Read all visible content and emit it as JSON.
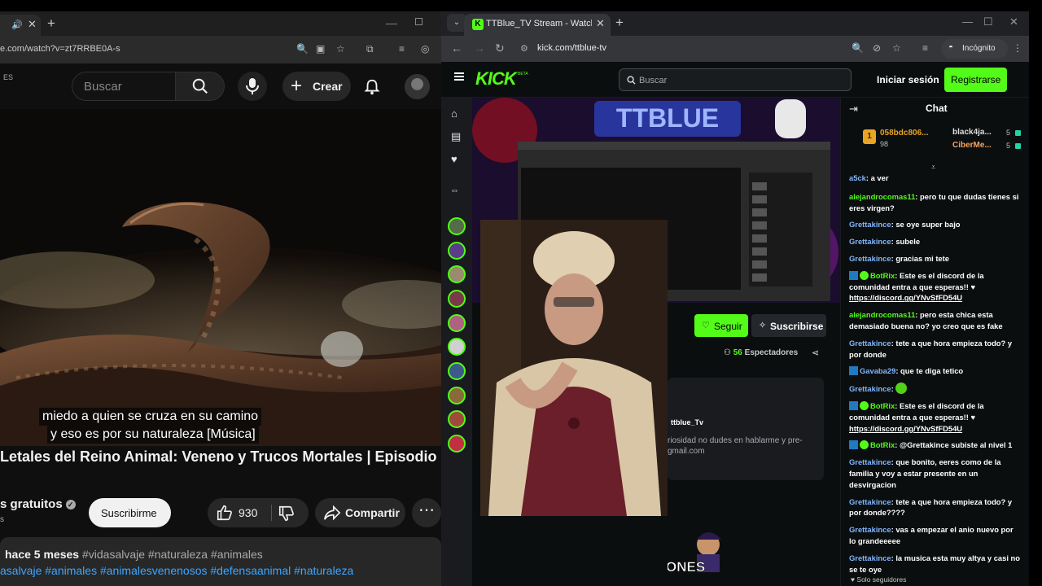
{
  "left_window": {
    "browser": {
      "url": "e.com/watch?v=zt7RRBE0A-s"
    },
    "youtube": {
      "lang_badge": "ES",
      "search_placeholder": "Buscar",
      "create_label": "Crear",
      "captions": [
        "miedo a quien se cruza en su camino",
        "y eso es por su naturaleza [Música]"
      ],
      "title": "Letales del Reino Animal: Veneno y Trucos Mortales | Episodio",
      "channel_name": "s gratuitos",
      "subscriber_line": "s",
      "subscribe_label": "Suscribirme",
      "likes": "930",
      "share_label": "Compartir",
      "more_label": "⋯",
      "posted": "hace 5 meses",
      "hashtags_line1": "#vidasalvaje #naturaleza #animales",
      "hashtags_line2": "asalvaje #animales #animalesvenenosos #defensaanimal #naturaleza"
    }
  },
  "right_window": {
    "browser": {
      "tab_title": "TTBlue_TV Stream - Watch",
      "url": "kick.com/ttblue-tv",
      "incognito_label": "Incógnito"
    },
    "kick": {
      "logo": "KICK",
      "beta": "BETA",
      "search_placeholder": "Buscar",
      "login_label": "Iniciar sesión",
      "register_label": "Registrarse",
      "stream_banner_text": "TTBLUE",
      "follow_label": "Seguir",
      "subscribe_label": "Suscribirse",
      "viewer_count": "56",
      "viewers_label": "Espectadores",
      "about_name": "ttblue_Tv",
      "about_bio_1": "riosidad no dudes en hablarme y pre-",
      "about_bio_2": "gmail.com",
      "banner_text": "ONES",
      "chat": {
        "title": "Chat",
        "top_supporters": [
          {
            "rank": "1",
            "name": "058bdc806...",
            "value": "98"
          },
          {
            "name": "black4ja...",
            "value": "5"
          },
          {
            "name": "CiberMe...",
            "value": "5"
          }
        ],
        "messages": [
          {
            "user": "a5ck",
            "color": "#80b6ff",
            "text": "a ver"
          },
          {
            "user": "alejandrocomas11",
            "color": "#53fc18",
            "text": "pero tu que dudas tienes si eres virgen?"
          },
          {
            "user": "Grettakince",
            "color": "#80b6ff",
            "text": "se oye super bajo"
          },
          {
            "user": "Grettakince",
            "color": "#80b6ff",
            "text": "subele"
          },
          {
            "user": "Grettakince",
            "color": "#80b6ff",
            "text": "gracias mi tete"
          },
          {
            "user": "BotRix",
            "color": "#53fc18",
            "bot": true,
            "text": "Este es el discord de la comunidad entra a que esperas!! ♥",
            "link": "https://discord.gg/YNvSfFD54U"
          },
          {
            "user": "alejandrocomas11",
            "color": "#53fc18",
            "text": "pero esta chica esta demasiado buena no? yo creo que es fake"
          },
          {
            "user": "Grettakince",
            "color": "#80b6ff",
            "text": "tete a que hora empieza todo? y por donde"
          },
          {
            "user": "Gavaba29",
            "color": "#80b6ff",
            "bot": false,
            "badge": true,
            "text": "que te diga tetico"
          },
          {
            "user": "Grettakince",
            "color": "#80b6ff",
            "emote": true,
            "text": ""
          },
          {
            "user": "BotRix",
            "color": "#53fc18",
            "bot": true,
            "text": "Este es el discord de la comunidad entra a que esperas!! ♥",
            "link": "https://discord.gg/YNvSfFD54U"
          },
          {
            "user": "BotRix",
            "color": "#53fc18",
            "bot": true,
            "text": "@Grettakince subiste al nivel 1"
          },
          {
            "user": "Grettakince",
            "color": "#80b6ff",
            "text": "que bonito, eeres como de la familia y voy a estar presente en un desvirgacion"
          },
          {
            "user": "Grettakince",
            "color": "#80b6ff",
            "text": "tete a que hora empieza todo? y por donde????"
          },
          {
            "user": "Grettakince",
            "color": "#80b6ff",
            "text": "vas a empezar el anio nuevo por lo grandeeeee"
          },
          {
            "user": "Grettakince",
            "color": "#80b6ff",
            "text": "la musica esta muy altya y casi no se te oye"
          }
        ],
        "footer": "♥ Solo seguidores"
      }
    }
  },
  "colors": {
    "kick_green": "#53fc18",
    "youtube_bg": "#0f0f0f",
    "kick_bg": "#0b0e0f",
    "youtube_link": "#3ea6ff"
  }
}
